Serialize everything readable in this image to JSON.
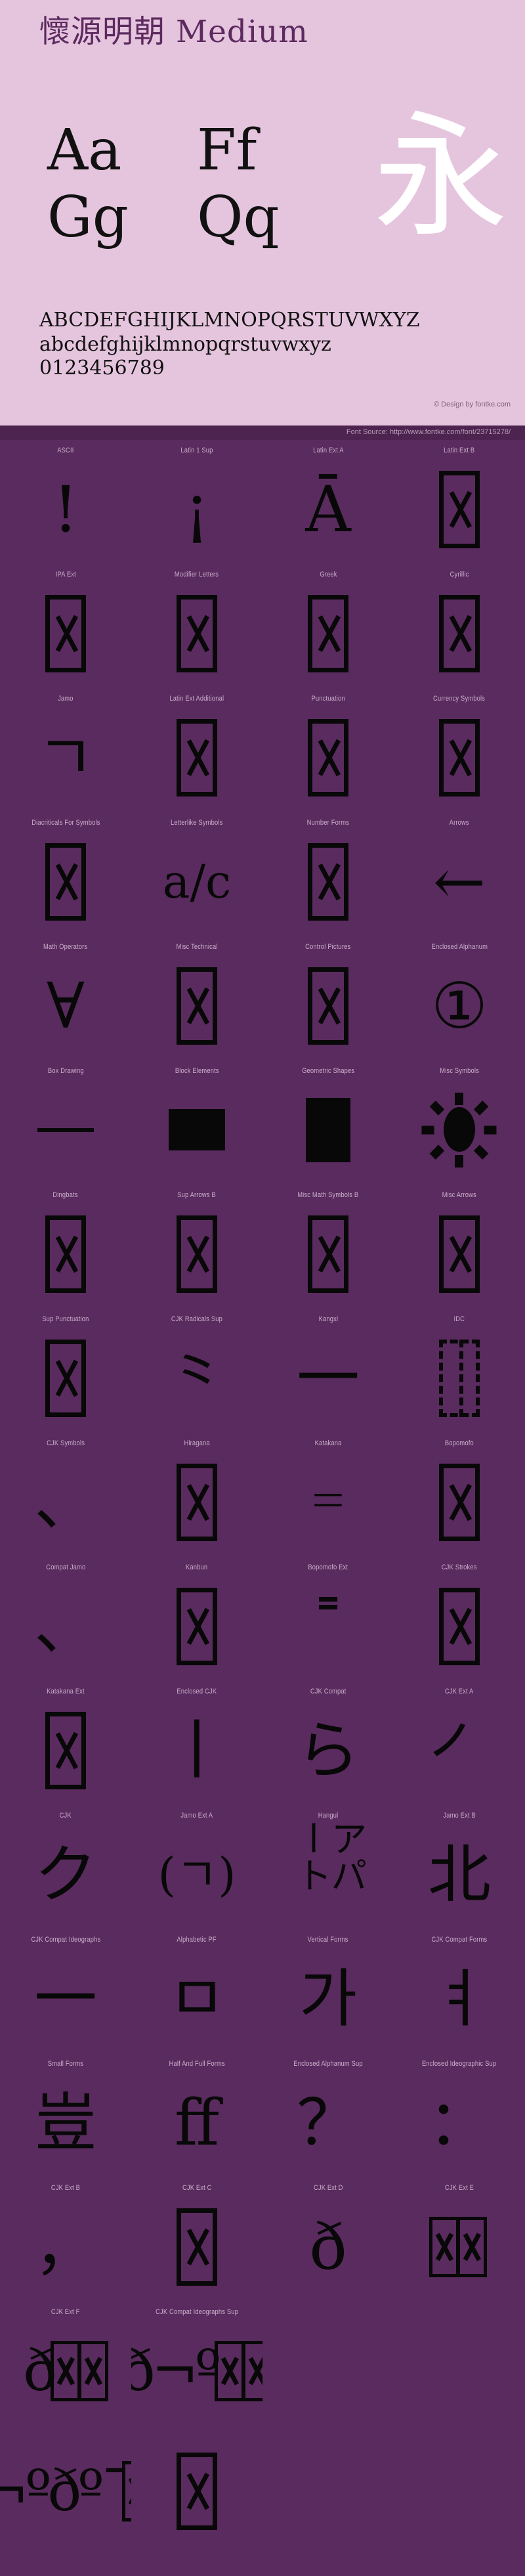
{
  "specimen": {
    "font_title": "懷源明朝 Medium",
    "big_samples": [
      "Aa",
      "Ff",
      "Gg",
      "Qq"
    ],
    "hero_glyph": "永",
    "alphabet_upper": "ABCDEFGHIJKLMNOPQRSTUVWXYZ",
    "alphabet_lower": "abcdefghijklmnopqrstuvwxyz",
    "digits": "0123456789",
    "design_credit": "© Design by fontke.com",
    "source_line": "Font Source: http://www.fontke.com/font/23715278/",
    "colors": {
      "header_background": "#e5c4dd",
      "title_color": "#5c2a5f",
      "hero_glyph_color": "#ffffff",
      "source_bar_background": "#4d2450",
      "grid_background": "#5a2b5e",
      "label_color": "#c9aecb",
      "glyph_color": "#080808"
    }
  },
  "grid": {
    "rows": [
      [
        {
          "label": "ASCII",
          "glyph": "!",
          "kind": "glyph"
        },
        {
          "label": "Latin 1 Sup",
          "glyph": "¡",
          "kind": "glyph"
        },
        {
          "label": "Latin Ext A",
          "glyph": "Ā",
          "kind": "glyph"
        },
        {
          "label": "Latin Ext B",
          "glyph": "",
          "kind": "tofu"
        }
      ],
      [
        {
          "label": "IPA Ext",
          "glyph": "",
          "kind": "tofu"
        },
        {
          "label": "Modifier Letters",
          "glyph": "",
          "kind": "tofu"
        },
        {
          "label": "Greek",
          "glyph": "",
          "kind": "tofu"
        },
        {
          "label": "Cyrillic",
          "glyph": "",
          "kind": "tofu"
        }
      ],
      [
        {
          "label": "Jamo",
          "glyph": "ㄱ",
          "kind": "glyph"
        },
        {
          "label": "Latin Ext Additional",
          "glyph": "",
          "kind": "tofu"
        },
        {
          "label": "Punctuation",
          "glyph": "",
          "kind": "tofu"
        },
        {
          "label": "Currency Symbols",
          "glyph": "",
          "kind": "tofu"
        }
      ],
      [
        {
          "label": "Diacriticals For Symbols",
          "glyph": "",
          "kind": "tofu"
        },
        {
          "label": "Letterlike Symbols",
          "glyph": "a/c",
          "kind": "glyph"
        },
        {
          "label": "Number Forms",
          "glyph": "",
          "kind": "tofu"
        },
        {
          "label": "Arrows",
          "glyph": "←",
          "kind": "glyph"
        }
      ],
      [
        {
          "label": "Math Operators",
          "glyph": "∀",
          "kind": "glyph"
        },
        {
          "label": "Misc Technical",
          "glyph": "",
          "kind": "tofu"
        },
        {
          "label": "Control Pictures",
          "glyph": "",
          "kind": "tofu"
        },
        {
          "label": "Enclosed Alphanum",
          "glyph": "①",
          "kind": "glyph"
        }
      ],
      [
        {
          "label": "Box Drawing",
          "glyph": "─",
          "kind": "boxline"
        },
        {
          "label": "Block Elements",
          "glyph": "█",
          "kind": "blockfill"
        },
        {
          "label": "Geometric Shapes",
          "glyph": "▮",
          "kind": "geomfill"
        },
        {
          "label": "Misc Symbols",
          "glyph": "☀",
          "kind": "sun"
        }
      ],
      [
        {
          "label": "Dingbats",
          "glyph": "",
          "kind": "tofu"
        },
        {
          "label": "Sup Arrows B",
          "glyph": "",
          "kind": "tofu"
        },
        {
          "label": "Misc Math Symbols B",
          "glyph": "",
          "kind": "tofu"
        },
        {
          "label": "Misc Arrows",
          "glyph": "",
          "kind": "tofu"
        }
      ],
      [
        {
          "label": "Sup Punctuation",
          "glyph": "",
          "kind": "tofu"
        },
        {
          "label": "CJK Radicals Sup",
          "glyph": "⺀",
          "kind": "glyph"
        },
        {
          "label": "Kangxi",
          "glyph": "⼀",
          "kind": "glyph"
        },
        {
          "label": "IDC",
          "glyph": "⿰",
          "kind": "dashed"
        }
      ],
      [
        {
          "label": "CJK Symbols",
          "glyph": "、",
          "kind": "glyph"
        },
        {
          "label": "Hiragana",
          "glyph": "",
          "kind": "tofu"
        },
        {
          "label": "Katakana",
          "glyph": "゠",
          "kind": "glyph"
        },
        {
          "label": "Bopomofo",
          "glyph": "",
          "kind": "tofu"
        }
      ],
      [
        {
          "label": "Compat Jamo",
          "glyph": "、",
          "kind": "glyph"
        },
        {
          "label": "Kanbun",
          "glyph": "",
          "kind": "tofu"
        },
        {
          "label": "Bopomofo Ext",
          "glyph": "˭",
          "kind": "glyph"
        },
        {
          "label": "CJK Strokes",
          "glyph": "",
          "kind": "tofu"
        }
      ],
      [
        {
          "label": "Katakana Ext",
          "glyph": "",
          "kind": "tofu"
        },
        {
          "label": "Enclosed CJK",
          "glyph": "丨",
          "kind": "glyph"
        },
        {
          "label": "CJK Compat",
          "glyph": "ら",
          "kind": "glyph"
        },
        {
          "label": "CJK Ext A",
          "glyph": "㇒",
          "kind": "glyph"
        }
      ],
      [
        {
          "label": "CJK",
          "glyph": "ク",
          "kind": "glyph"
        },
        {
          "label": "Jamo Ext A",
          "glyph": "(ㄱ)",
          "kind": "glyph"
        },
        {
          "label": "Hangul",
          "glyph": "アパート",
          "kind": "vertical"
        },
        {
          "label": "Jamo Ext B",
          "glyph": "北",
          "kind": "glyph"
        }
      ],
      [
        {
          "label": "CJK Compat Ideographs",
          "glyph": "一",
          "kind": "glyph"
        },
        {
          "label": "Alphabetic PF",
          "glyph": "ㅁ",
          "kind": "glyph"
        },
        {
          "label": "Vertical Forms",
          "glyph": "가",
          "kind": "glyph"
        },
        {
          "label": "CJK Compat Forms",
          "glyph": "ㅕ",
          "kind": "glyph"
        }
      ],
      [
        {
          "label": "Small Forms",
          "glyph": "豈",
          "kind": "glyph"
        },
        {
          "label": "Half And Full Forms",
          "glyph": "ff",
          "kind": "glyph"
        },
        {
          "label": "Enclosed Alphanum Sup",
          "glyph": "？",
          "kind": "glyph"
        },
        {
          "label": "Enclosed Ideographic Sup",
          "glyph": "：",
          "kind": "glyph"
        }
      ],
      [
        {
          "label": "CJK Ext B",
          "glyph": "，",
          "kind": "glyph"
        },
        {
          "label": "CJK Ext C",
          "glyph": "",
          "kind": "tofu"
        },
        {
          "label": "CJK Ext D",
          "glyph": "ð",
          "kind": "glyph"
        },
        {
          "label": "CJK Ext E",
          "glyph": "",
          "kind": "multi"
        }
      ],
      [
        {
          "label": "CJK Ext F",
          "glyph": "ð",
          "kind": "multi"
        },
        {
          "label": "CJK Compat Ideographs Sup",
          "glyph": "ð¬º",
          "kind": "multi"
        },
        {
          "label": "",
          "glyph": "",
          "kind": "empty"
        },
        {
          "label": "",
          "glyph": "",
          "kind": "empty"
        }
      ],
      [
        {
          "label": "",
          "glyph": "ð¬ºðº¯",
          "kind": "multi-tail"
        },
        {
          "label": "",
          "glyph": "",
          "kind": "tofu-tail"
        },
        {
          "label": "",
          "glyph": "",
          "kind": "empty"
        },
        {
          "label": "",
          "glyph": "",
          "kind": "empty"
        }
      ]
    ]
  }
}
